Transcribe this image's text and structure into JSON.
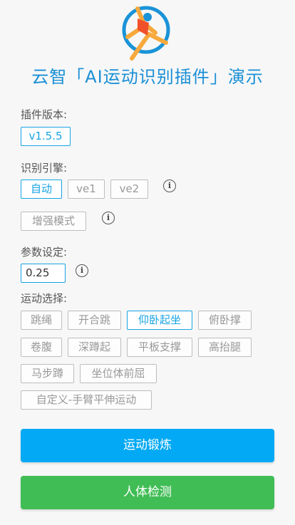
{
  "title": "云智「AI运动识别插件」演示",
  "plugin_version": {
    "label": "插件版本:",
    "value": "v1.5.5"
  },
  "engine": {
    "label": "识别引擎:",
    "options": [
      "自动",
      "ve1",
      "ve2"
    ],
    "selected": "自动",
    "enhance_mode": "增强模式"
  },
  "params": {
    "label": "参数设定:",
    "value": "0.25"
  },
  "sports": {
    "label": "运动选择:",
    "items": [
      "跳绳",
      "开合跳",
      "仰卧起坐",
      "俯卧撑",
      "卷腹",
      "深蹲起",
      "平板支撑",
      "高抬腿",
      "马步蹲",
      "坐位体前屈",
      "自定义-手臂平伸运动"
    ],
    "selected": "仰卧起坐"
  },
  "buttons": {
    "exercise": "运动锻炼",
    "body_detect": "人体检测"
  },
  "colors": {
    "accent": "#18a3e3",
    "primary_button": "#03a9f4",
    "success_button": "#40bd55"
  },
  "icons": {
    "logo": "sport-figure-logo",
    "info": "info-icon"
  }
}
